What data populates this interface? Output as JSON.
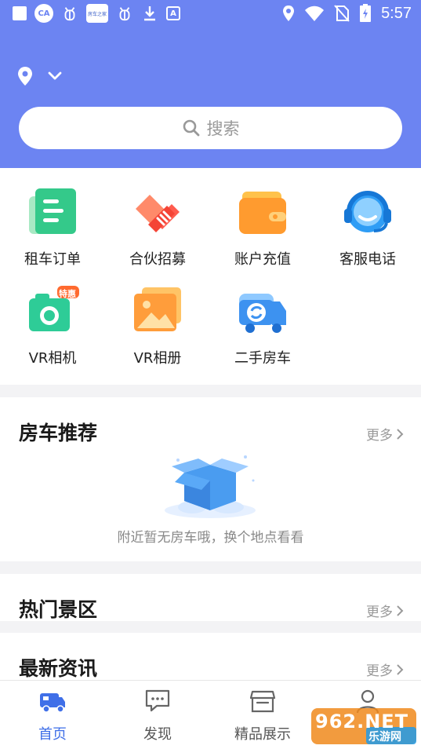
{
  "status_bar": {
    "time": "5:57",
    "left_icons": [
      "square-notification-icon",
      "ca-app-icon",
      "bug-icon",
      "app-logo-icon",
      "bug-icon",
      "download-icon",
      "a-icon"
    ],
    "right_icons": [
      "location-icon",
      "wifi-icon",
      "no-sim-icon",
      "battery-charging-icon"
    ],
    "app_logo_text": "房车之家"
  },
  "header": {
    "background": "#6c84f2",
    "search": {
      "placeholder": "搜索"
    }
  },
  "menu": {
    "items": [
      {
        "label": "租车订单",
        "icon": "rental-order-icon"
      },
      {
        "label": "合伙招募",
        "icon": "partner-handshake-icon"
      },
      {
        "label": "账户充值",
        "icon": "wallet-icon"
      },
      {
        "label": "客服电话",
        "icon": "headset-icon"
      },
      {
        "label": "VR相机",
        "icon": "vr-camera-icon",
        "badge": "特惠"
      },
      {
        "label": "VR相册",
        "icon": "vr-album-icon"
      },
      {
        "label": "二手房车",
        "icon": "used-rv-icon"
      }
    ]
  },
  "sections": {
    "rv_recommend": {
      "title": "房车推荐",
      "more": "更多",
      "empty_text": "附近暂无房车哦，换个地点看看"
    },
    "hot_spots": {
      "title": "热门景区",
      "more": "更多"
    },
    "news": {
      "title": "最新资讯",
      "more": "更多"
    }
  },
  "bottom_nav": {
    "items": [
      {
        "label": "首页",
        "icon": "rv-home-icon",
        "active": true
      },
      {
        "label": "发现",
        "icon": "chat-bubble-icon",
        "active": false
      },
      {
        "label": "精品展示",
        "icon": "store-icon",
        "active": false
      },
      {
        "label": "",
        "icon": "user-icon",
        "active": false
      }
    ]
  },
  "watermark": {
    "text": "962.NET",
    "sub": "乐游网"
  }
}
